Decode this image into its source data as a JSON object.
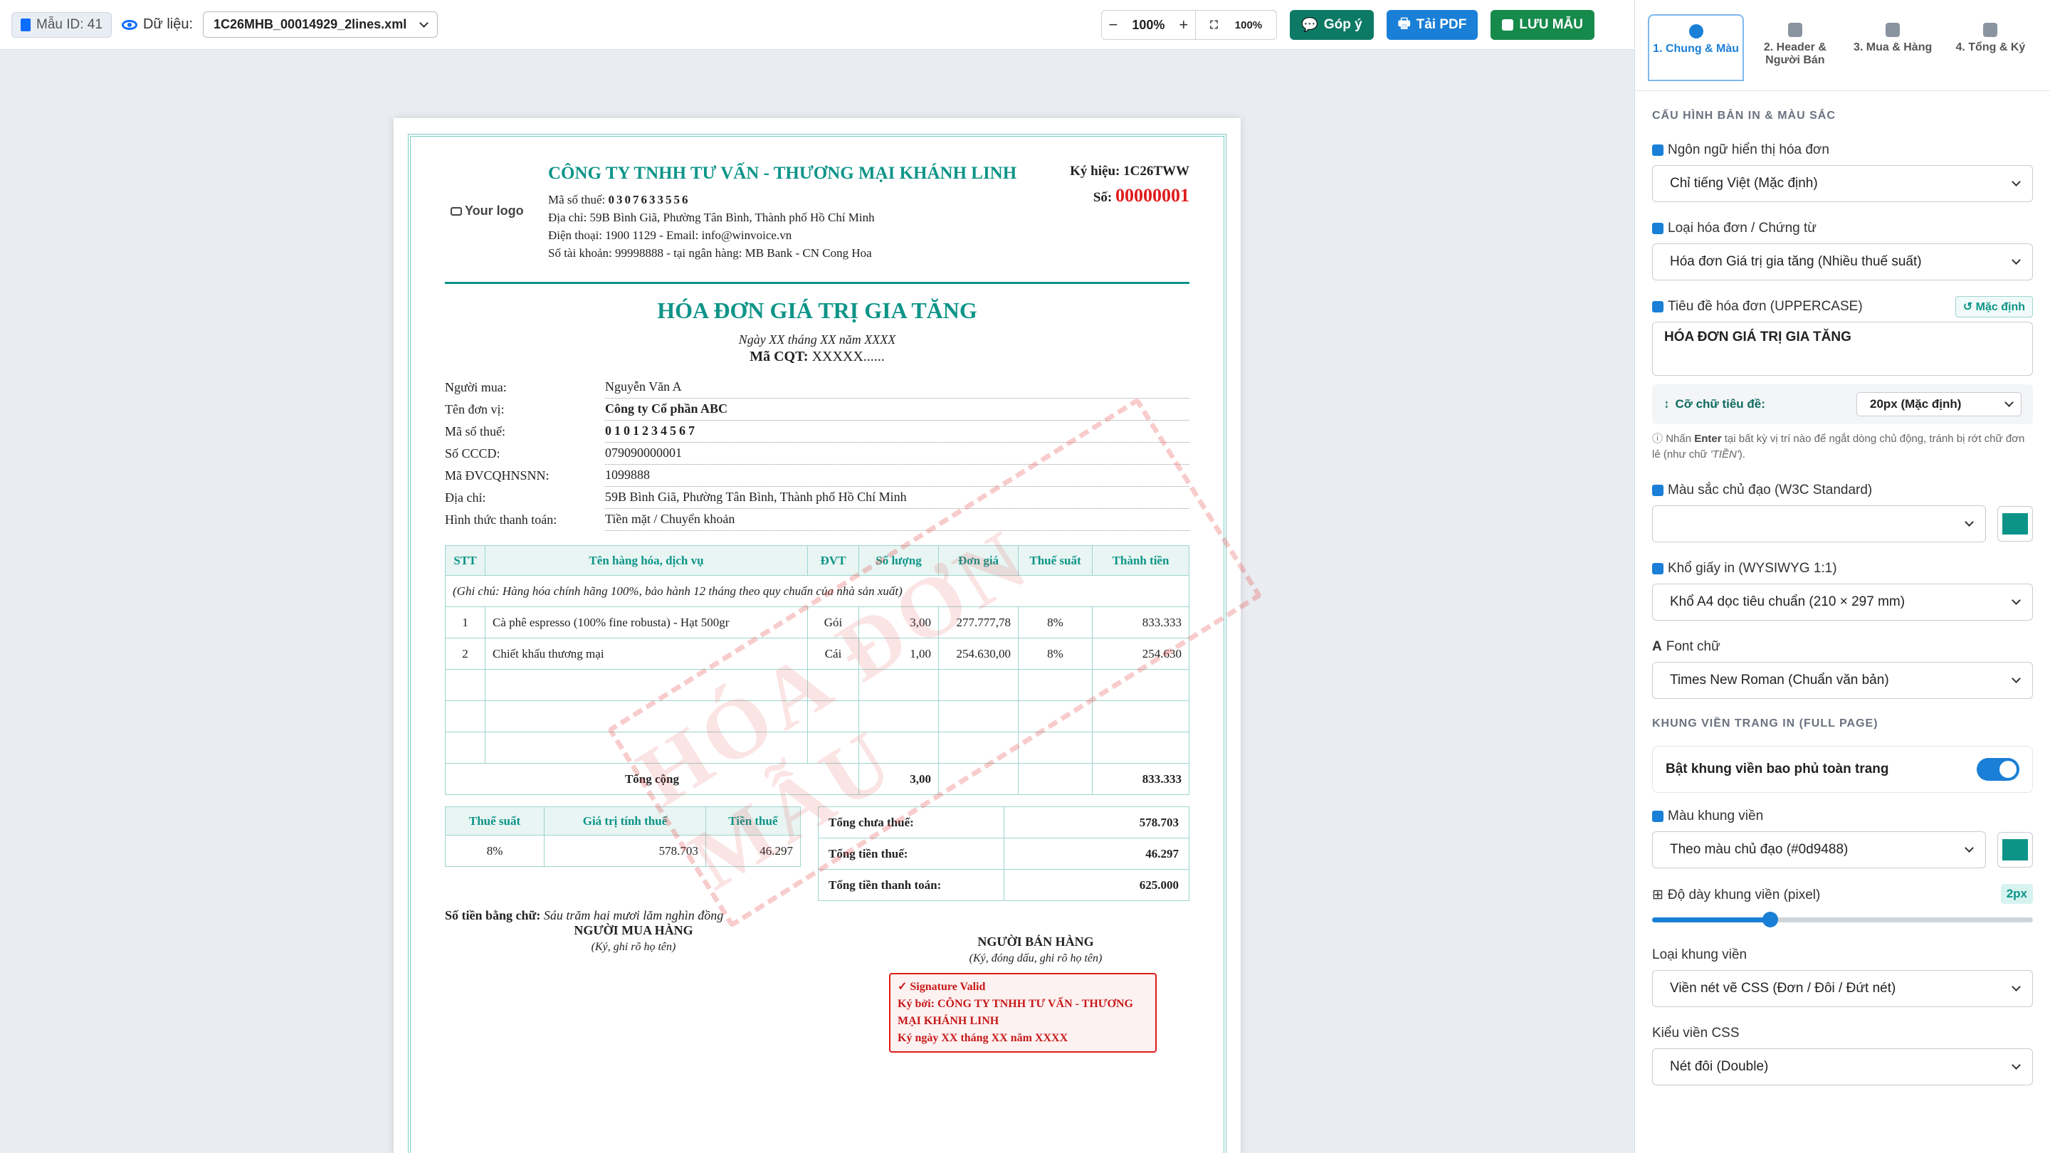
{
  "toolbar": {
    "template_id": "Mẫu ID: 41",
    "data_label": "Dữ liệu:",
    "data_file": "1C26MHB_00014929_2lines.xml",
    "zoom_minus": "−",
    "zoom_value": "100%",
    "zoom_plus": "+",
    "zoom_fit": "100%",
    "feedback_btn": "Góp ý",
    "pdf_btn": "Tải PDF",
    "save_btn": "LƯU MẪU"
  },
  "invoice": {
    "logo": "Your logo",
    "company_name": "CÔNG TY TNHH TƯ VẤN - THƯƠNG MẠI KHÁNH LINH",
    "tax_label": "Mã số thuế:",
    "tax_code": "0307633556",
    "address": "Địa chỉ: 59B Bình Giã, Phường Tân Bình, Thành phố Hồ Chí Minh",
    "phone": "Điện thoại: 1900 1129 - Email: info@winvoice.vn",
    "bank": "Số tài khoản: 99998888 - tại ngân hàng: MB Bank - CN Cong Hoa",
    "symbol_label": "Ký hiệu:",
    "symbol": "1C26TWW",
    "number_label": "Số:",
    "number": "00000001",
    "title": "HÓA ĐƠN GIÁ TRỊ GIA TĂNG",
    "date": "Ngày XX tháng XX năm XXXX",
    "cqt_label": "Mã CQT:",
    "cqt_value": "XXXXX......",
    "buyer": [
      {
        "label": "Người mua:",
        "value": "Nguyễn Văn A",
        "style": ""
      },
      {
        "label": "Tên đơn vị:",
        "value": "Công ty Cổ phần ABC",
        "style": "bold"
      },
      {
        "label": "Mã số thuế:",
        "value": "0101234567",
        "style": "spaced"
      },
      {
        "label": "Số CCCD:",
        "value": "079090000001",
        "style": ""
      },
      {
        "label": "Mã ĐVCQHNSNN:",
        "value": "1099888",
        "style": ""
      },
      {
        "label": "Địa chỉ:",
        "value": "59B Bình Giã, Phường Tân Bình, Thành phố Hồ Chí Minh",
        "style": ""
      },
      {
        "label": "Hình thức thanh toán:",
        "value": "Tiền mặt / Chuyển khoản",
        "style": ""
      }
    ],
    "item_headers": [
      "STT",
      "Tên hàng hóa, dịch vụ",
      "ĐVT",
      "Số lượng",
      "Đơn giá",
      "Thuế suất",
      "Thành tiền"
    ],
    "item_note": "(Ghi chú: Hàng hóa chính hãng 100%, bảo hành 12 tháng theo quy chuẩn của nhà sản xuất)",
    "items": [
      [
        "1",
        "Cà phê espresso (100% fine robusta) - Hạt 500gr",
        "Gói",
        "3,00",
        "277.777,78",
        "8%",
        "833.333"
      ],
      [
        "2",
        "Chiết khấu thương mại",
        "Cái",
        "1,00",
        "254.630,00",
        "8%",
        "254.630"
      ]
    ],
    "total_label": "Tổng cộng",
    "total_qty": "3,00",
    "total_amount": "833.333",
    "vat_headers": [
      "Thuế suất",
      "Giá trị tính thuế",
      "Tiền thuế"
    ],
    "vat_row": [
      "8%",
      "578.703",
      "46.297"
    ],
    "summary": [
      {
        "label": "Tổng chưa thuế:",
        "value": "578.703"
      },
      {
        "label": "Tổng tiền thuế:",
        "value": "46.297"
      },
      {
        "label": "Tổng tiền thanh toán:",
        "value": "625.000"
      }
    ],
    "words_label": "Số tiền bằng chữ:",
    "words_value": "Sáu trăm hai mươi lăm nghìn đồng",
    "buyer_sign_title": "NGƯỜI MUA HÀNG",
    "buyer_sign_sub": "(Ký, ghi rõ họ tên)",
    "seller_sign_title": "NGƯỜI BÁN HÀNG",
    "seller_sign_sub": "(Ký, đóng dấu, ghi rõ họ tên)",
    "sig_valid": "✓ Signature Valid",
    "sig_by": "Ký bởi: CÔNG TY TNHH TƯ VẤN - THƯƠNG MẠI KHÁNH LINH",
    "sig_date": "Ký ngày XX tháng XX năm XXXX",
    "watermark": "HÓA ĐƠN MẪU"
  },
  "panel": {
    "tabs": [
      "1. Chung & Màu",
      "2. Header & Người Bán",
      "3. Mua & Hàng",
      "4. Tổng & Ký"
    ],
    "section_print": "CẤU HÌNH BẢN IN & MÀU SẮC",
    "lang_label": "Ngôn ngữ hiển thị hóa đơn",
    "lang_value": "Chỉ tiếng Việt (Mặc định)",
    "type_label": "Loại hóa đơn / Chứng từ",
    "type_value": "Hóa đơn Giá trị gia tăng (Nhiều thuế suất)",
    "title_label": "Tiêu đề hóa đơn (UPPERCASE)",
    "reset_label": "Mặc định",
    "title_value": "HÓA ĐƠN GIÁ TRỊ GIA TĂNG",
    "font_size_label": "Cỡ chữ tiêu đề:",
    "font_size_value": "20px (Mặc định)",
    "hint_pre": "Nhấn",
    "hint_key": "Enter",
    "hint_mid": "tại bất kỳ vị trí nào để ngắt dòng chủ động, tránh bị rớt chữ đơn lẻ (như chữ",
    "hint_word": "'TIỀN'",
    "hint_end": ").",
    "color_label": "Màu sắc chủ đạo (W3C Standard)",
    "color_value": "",
    "paper_label": "Khổ giấy in (WYSIWYG 1:1)",
    "paper_value": "Khổ A4 dọc tiêu chuẩn (210 × 297 mm)",
    "font_label": "Font chữ",
    "font_value": "Times New Roman (Chuẩn văn bản)",
    "section_border": "KHUNG VIỀN TRANG IN (FULL PAGE)",
    "border_toggle": "Bật khung viền bao phủ toàn trang",
    "border_color_label": "Màu khung viền",
    "border_color_value": "Theo màu chủ đạo (#0d9488)",
    "thickness_label": "Độ dày khung viền (pixel)",
    "thickness_value": "2px",
    "thickness_fraction": 0.31,
    "border_type_label": "Loại khung viền",
    "border_type_value": "Viền nét vẽ CSS (Đơn / Đôi / Đứt nét)",
    "css_style_label": "Kiểu viền CSS",
    "css_style_value": "Nét đôi (Double)",
    "accent_color": "#0d9488"
  }
}
